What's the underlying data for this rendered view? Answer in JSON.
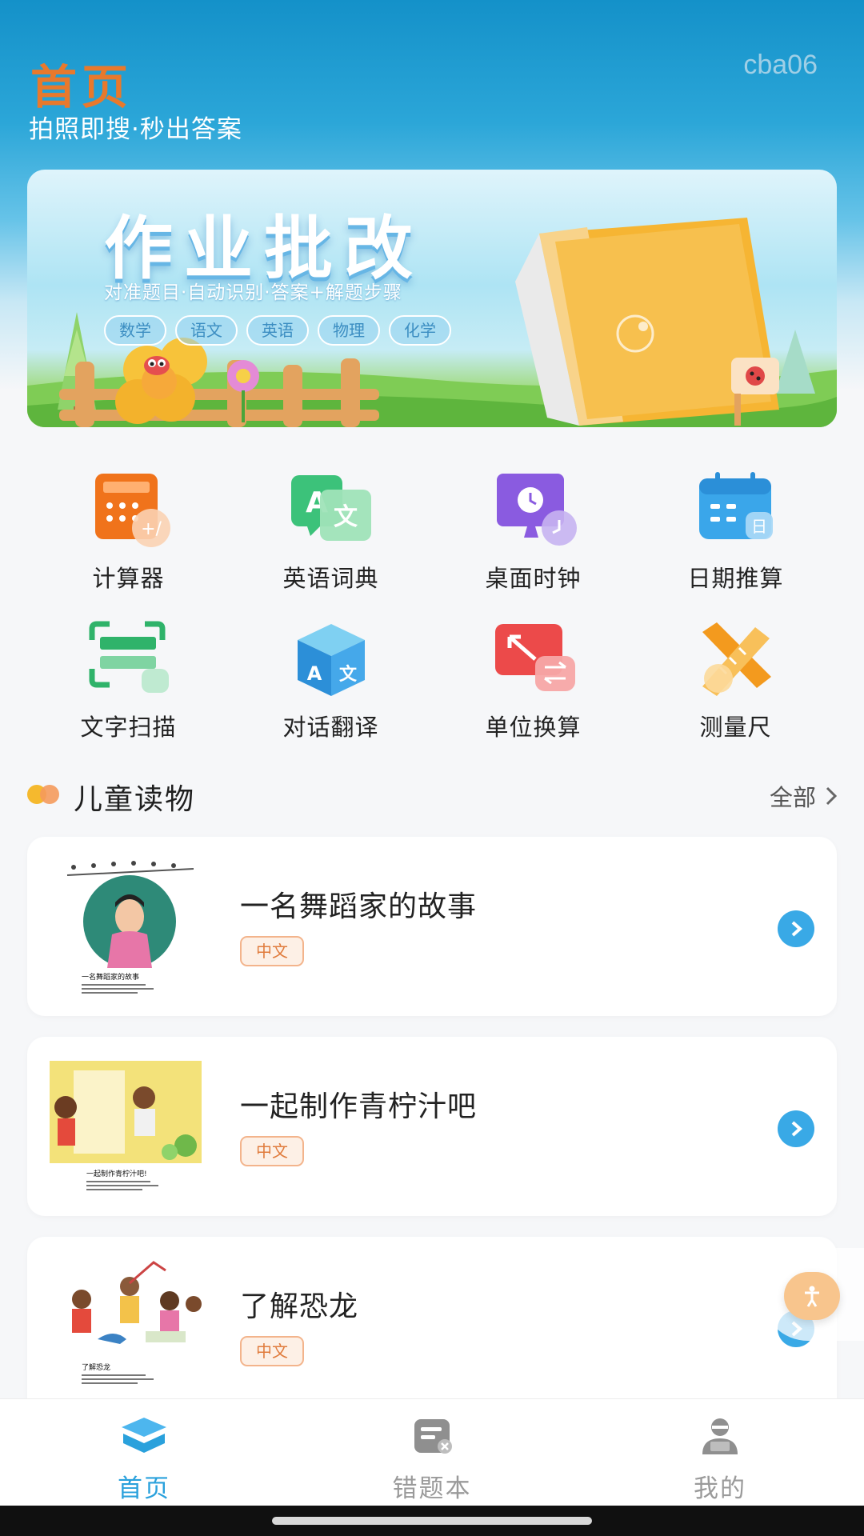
{
  "header": {
    "title": "首页",
    "subtitle": "拍照即搜·秒出答案",
    "user_id": "cba06"
  },
  "banner": {
    "title": "作业批改",
    "subtitle": "对准题目·自动识别·答案+解题步骤",
    "tags": [
      "数学",
      "语文",
      "英语",
      "物理",
      "化学"
    ]
  },
  "tools": [
    {
      "label": "计算器",
      "icon": "calculator-icon"
    },
    {
      "label": "英语词典",
      "icon": "dictionary-icon"
    },
    {
      "label": "桌面时钟",
      "icon": "clock-icon"
    },
    {
      "label": "日期推算",
      "icon": "calendar-icon"
    },
    {
      "label": "文字扫描",
      "icon": "scan-icon"
    },
    {
      "label": "对话翻译",
      "icon": "translate-icon"
    },
    {
      "label": "单位换算",
      "icon": "unit-convert-icon"
    },
    {
      "label": "测量尺",
      "icon": "ruler-icon"
    }
  ],
  "section": {
    "title": "儿童读物",
    "more": "全部"
  },
  "books": [
    {
      "title": "一名舞蹈家的故事",
      "tag": "中文",
      "cover_caption": "一名舞蹈家的故事"
    },
    {
      "title": "一起制作青柠汁吧",
      "tag": "中文",
      "cover_caption": "一起制作青柠汁吧!"
    },
    {
      "title": "了解恐龙",
      "tag": "中文",
      "cover_caption": "了解恐龙"
    }
  ],
  "nav": [
    {
      "label": "首页",
      "icon": "home-icon",
      "active": true
    },
    {
      "label": "错题本",
      "icon": "mistake-book-icon",
      "active": false
    },
    {
      "label": "我的",
      "icon": "profile-icon",
      "active": false
    }
  ],
  "colors": {
    "accent": "#2aa1dc",
    "title_orange": "#e8792c",
    "tag_orange": "#e07b3c"
  }
}
